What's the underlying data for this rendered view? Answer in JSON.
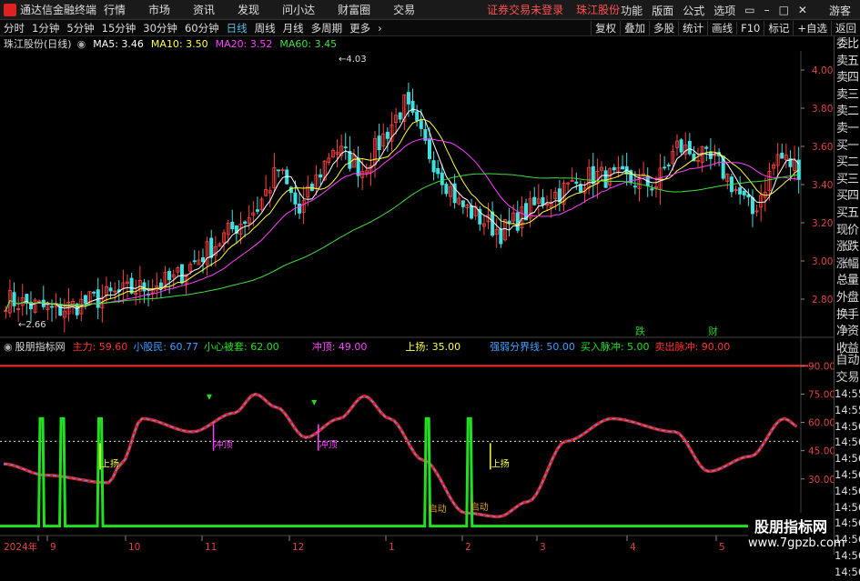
{
  "titlebar": {
    "app_name": "通达信金融终端",
    "menu": [
      "行情",
      "市场",
      "资讯",
      "发现",
      "问小达",
      "财富圈",
      "交易"
    ],
    "login_status": "证券交易未登录",
    "broker": "珠江股份",
    "right_menu": [
      "功能",
      "版面",
      "公式",
      "选项"
    ],
    "guest": "游客"
  },
  "toolbar": {
    "periods": [
      "分时",
      "1分钟",
      "5分钟",
      "15分钟",
      "30分钟",
      "60分钟",
      "日线",
      "周线",
      "月线",
      "多周期",
      "更多"
    ],
    "active_period": "日线",
    "right_tools": [
      "复权",
      "叠加",
      "多股",
      "统计",
      "画线",
      "F10",
      "标记",
      "+自选",
      "返回"
    ]
  },
  "main_chart": {
    "stock_label": "珠江股份(日线)",
    "ma": [
      {
        "name": "MA5",
        "value": "3.46",
        "color": "#ffffff"
      },
      {
        "name": "MA10",
        "value": "3.50",
        "color": "#ffff40"
      },
      {
        "name": "MA20",
        "value": "3.52",
        "color": "#ff40ff"
      },
      {
        "name": "MA60",
        "value": "3.45",
        "color": "#40e040"
      }
    ],
    "y_ticks": [
      "4.00",
      "3.80",
      "3.60",
      "3.40",
      "3.20",
      "3.00",
      "2.80"
    ],
    "high_label": "4.03",
    "low_label": "2.66",
    "markers": [
      {
        "text": "跌",
        "color": "#20d020"
      },
      {
        "text": "财",
        "color": "#20d020"
      }
    ]
  },
  "sub_chart": {
    "name": "股朋指标网",
    "params": [
      {
        "label": "主力: 59.60",
        "color": "#ff3030"
      },
      {
        "label": "小股民: 60.77",
        "color": "#40a0ff"
      },
      {
        "label": "小心被套: 62.00",
        "color": "#20e020"
      },
      {
        "label": "冲顶: 49.00",
        "color": "#ff40ff"
      },
      {
        "label": "上扬: 35.00",
        "color": "#ffff40"
      },
      {
        "label": "强弱分界线: 50.00",
        "color": "#40a0ff"
      },
      {
        "label": "买入脉冲: 5.00",
        "color": "#20e020"
      },
      {
        "label": "卖出脉冲: 90.00",
        "color": "#ff3030"
      }
    ],
    "y_ticks": [
      "90.00",
      "75.00",
      "60.00",
      "45.00",
      "30.00"
    ],
    "annotations": [
      "冲顶",
      "冲顶",
      "上扬",
      "上扬",
      "启动",
      "启动"
    ]
  },
  "x_axis": {
    "labels": [
      "2024年",
      "9",
      "10",
      "11",
      "12",
      "1",
      "2",
      "3",
      "4",
      "5"
    ]
  },
  "right_panel": {
    "items": [
      "委比",
      "卖五",
      "卖四",
      "卖三",
      "卖二",
      "卖一",
      "买一",
      "买二",
      "买三",
      "买四",
      "买五",
      "现价",
      "涨跌",
      "涨幅",
      "总量",
      "外盘",
      "换手",
      "净资",
      "收益"
    ],
    "auto_label": "自动",
    "trade_label": "交易",
    "times": [
      "14:55",
      "14:55",
      "14:56",
      "14:56",
      "14:56",
      "14:56",
      "14:56",
      "14:56",
      "14:56",
      "14:56",
      "14:56",
      "14:56"
    ]
  },
  "watermark": {
    "line1": "股朋指标网",
    "line2": "www.7gpzb.com"
  }
}
